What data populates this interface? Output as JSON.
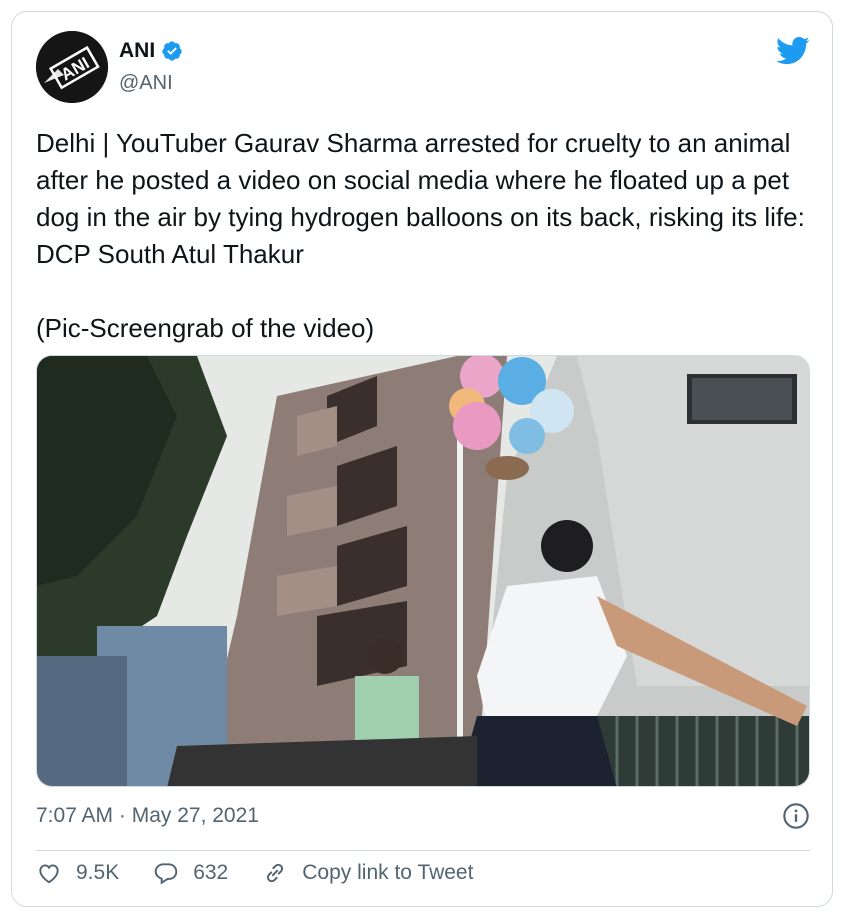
{
  "author": {
    "name": "ANI",
    "handle": "@ANI",
    "avatar_text": "ANI",
    "verified": true
  },
  "tweet": {
    "text_main": "Delhi | YouTuber Gaurav Sharma arrested for cruelty to an animal after he posted a video on social media where he floated up a pet dog in the air by tying hydrogen balloons on its back, risking its life: DCP South Atul Thakur",
    "text_caption": "(Pic-Screengrab of the video)",
    "timestamp": "7:07 AM · May 27, 2021"
  },
  "actions": {
    "likes": "9.5K",
    "replies": "632",
    "copy_link": "Copy link to Tweet"
  },
  "icons": [
    "verified-badge-icon",
    "twitter-bird-icon",
    "info-icon",
    "heart-icon",
    "reply-icon",
    "link-icon"
  ],
  "colors": {
    "brand_blue": "#1d9bf0",
    "text_primary": "#0f1419",
    "text_secondary": "#536471",
    "border": "#cfd9de"
  }
}
